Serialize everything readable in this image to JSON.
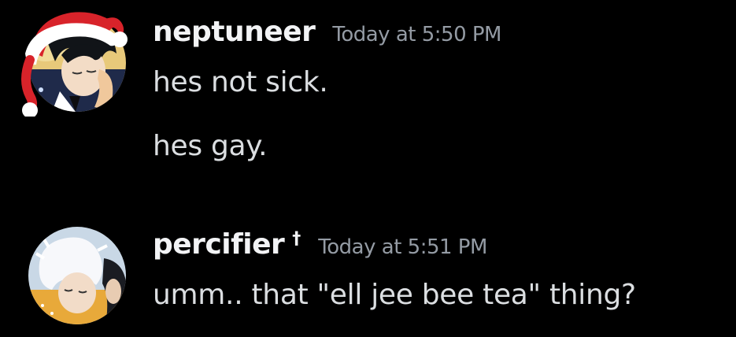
{
  "messages": [
    {
      "username": "neptuneer",
      "badge": "",
      "timestamp": "Today at 5:50 PM",
      "avatar_icon": "anime-avatar-dark-hair",
      "decoration_icon": "santa-hat-icon",
      "lines": [
        "hes not sick.",
        "hes gay."
      ]
    },
    {
      "username": "percifier",
      "badge": "†",
      "timestamp": "Today at 5:51 PM",
      "avatar_icon": "anime-avatar-white-hair",
      "lines": [
        "umm.. that \"ell jee bee tea\" thing?"
      ]
    }
  ],
  "colors": {
    "background": "#000000",
    "username": "#f2f3f5",
    "timestamp": "#949ba4",
    "message_text": "#dbdee1",
    "hat_red": "#d8232a",
    "hat_white": "#ffffff"
  }
}
